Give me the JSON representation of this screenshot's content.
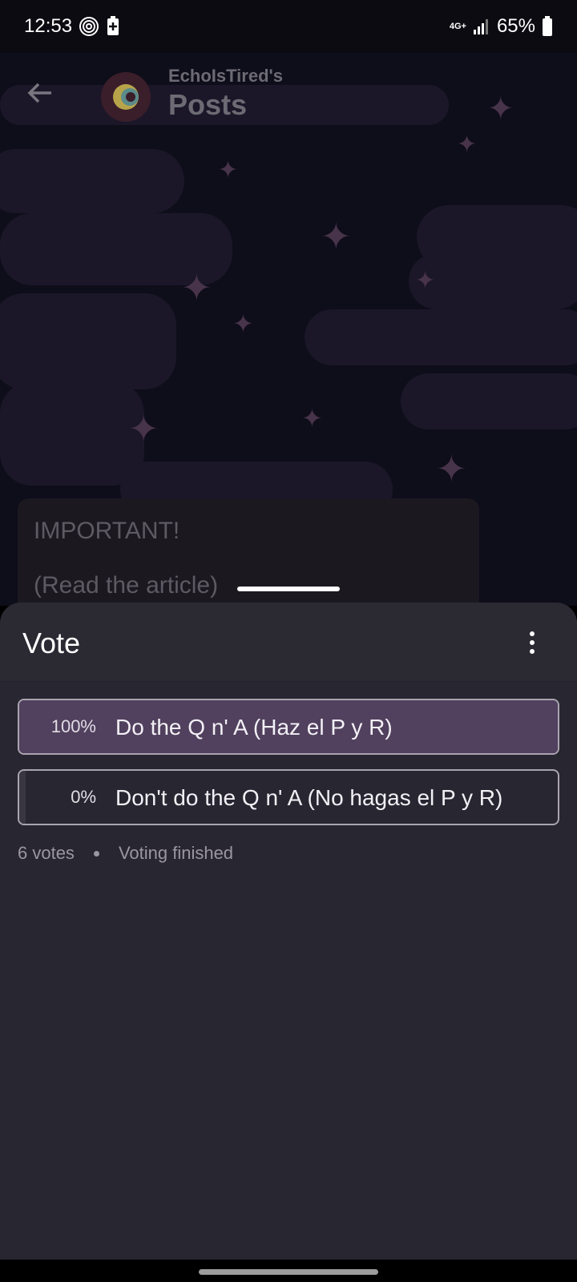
{
  "status_bar": {
    "time": "12:53",
    "network": "4G+",
    "battery": "65%"
  },
  "app_bar": {
    "subtitle": "EchoIsTired's",
    "title": "Posts"
  },
  "post": {
    "line1": "IMPORTANT!",
    "line2": "(Read the article)"
  },
  "sheet": {
    "title": "Vote",
    "options": [
      {
        "percent": "100%",
        "label": "Do the Q n' A (Haz el P y R)",
        "share": 1.0
      },
      {
        "percent": "0%",
        "label": "Don't do the Q n' A (No hagas el P y R)",
        "share": 0.0
      }
    ],
    "votes": "6 votes",
    "status": "Voting finished"
  },
  "colors": {
    "sheet_bg": "#282630",
    "winner_fill": "#51405e",
    "option_border": "#a9a5b0"
  }
}
